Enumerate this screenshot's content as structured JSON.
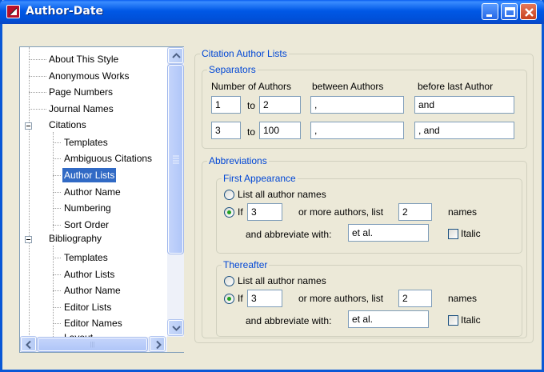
{
  "window": {
    "title": "Author-Date"
  },
  "tree": {
    "items": [
      "About This Style",
      "Anonymous Works",
      "Page Numbers",
      "Journal Names",
      "Citations",
      "Templates",
      "Ambiguous Citations",
      "Author Lists",
      "Author Name",
      "Numbering",
      "Sort Order",
      "Bibliography",
      "Templates",
      "Author Lists",
      "Author Name",
      "Editor Lists",
      "Editor Names",
      "Layout"
    ],
    "selected": "Author Lists",
    "hscroll_grip": "|||"
  },
  "citation_author_lists": {
    "legend": "Citation Author Lists",
    "separators": {
      "legend": "Separators",
      "col_number": "Number of Authors",
      "col_between": "between Authors",
      "col_before_last": "before last Author",
      "to_label": "to",
      "rows": [
        {
          "from": "1",
          "to": "2",
          "between": ",",
          "before_last": "and"
        },
        {
          "from": "3",
          "to": "100",
          "between": ",",
          "before_last": ", and"
        }
      ]
    },
    "abbreviations": {
      "legend": "Abbreviations",
      "first": {
        "legend": "First Appearance",
        "list_all": "List all author names",
        "if_label": "If",
        "if_value": "3",
        "more_authors": "or more authors, list",
        "list_value": "2",
        "names": "names",
        "abbreviate": "and abbreviate with:",
        "abbrev_value": "et al.",
        "italic": "Italic"
      },
      "thereafter": {
        "legend": "Thereafter",
        "list_all": "List all author names",
        "if_label": "If",
        "if_value": "3",
        "more_authors": "or more authors, list",
        "list_value": "2",
        "names": "names",
        "abbreviate": "and abbreviate with:",
        "abbrev_value": "et al.",
        "italic": "Italic"
      }
    }
  }
}
